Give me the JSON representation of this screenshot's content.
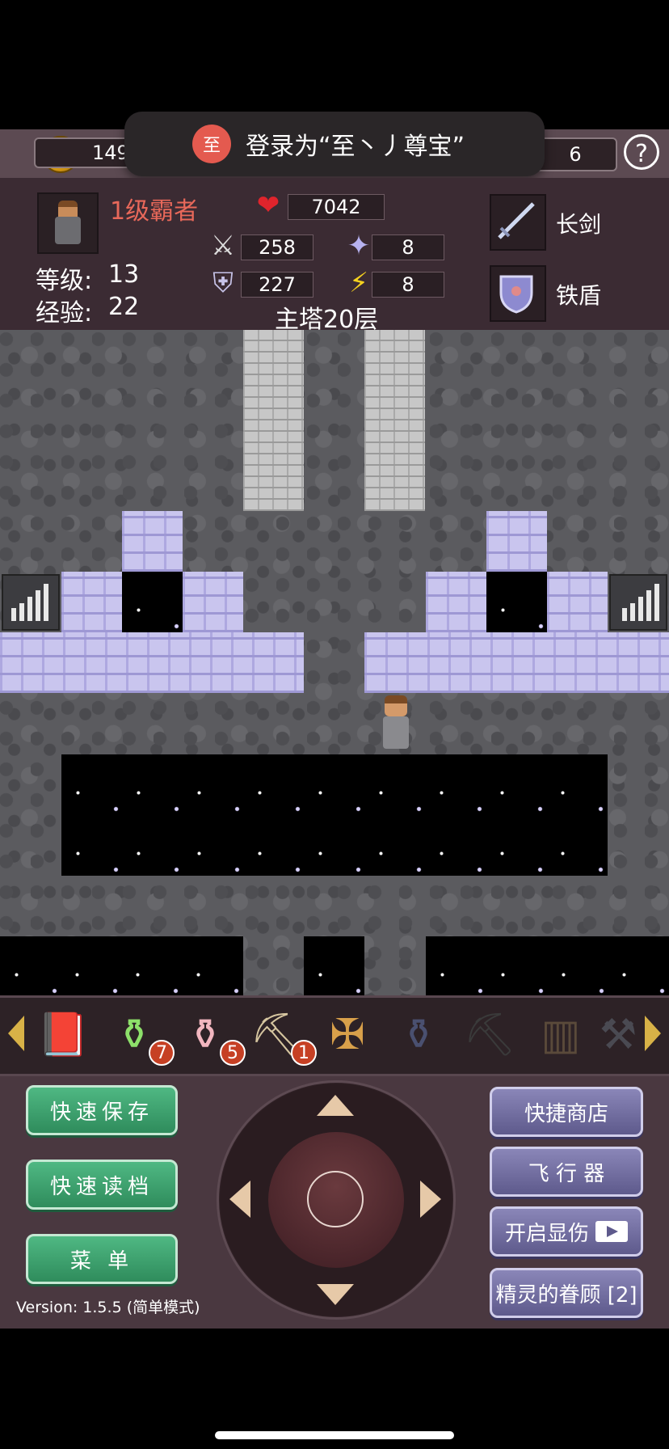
{
  "topbar": {
    "coins": "149",
    "right_value": "6",
    "help_label": "?"
  },
  "toast": {
    "avatar_char": "至",
    "text": "登录为“至丶丿尊宝”"
  },
  "hero": {
    "title": "1级霸者",
    "level_label": "等级:",
    "level": "13",
    "exp_label": "经验:",
    "exp": "22",
    "hp": "7042",
    "attack": "258",
    "defense": "227",
    "magic_def": "8",
    "speed": "8"
  },
  "equipment": {
    "weapon": "长剑",
    "shield": "铁盾"
  },
  "floor": "主塔20层",
  "items": [
    {
      "icon": "red-book-icon",
      "count": ""
    },
    {
      "icon": "green-potion-icon",
      "count": "7"
    },
    {
      "icon": "pink-potion-icon",
      "count": "5"
    },
    {
      "icon": "pickaxe-icon",
      "count": "1"
    },
    {
      "icon": "cross-staff-icon",
      "count": ""
    },
    {
      "icon": "dark-vase-icon",
      "count": ""
    },
    {
      "icon": "dark-pickaxe-icon",
      "count": ""
    },
    {
      "icon": "rune-tablet-icon",
      "count": ""
    },
    {
      "icon": "hammer-icon",
      "count": ""
    }
  ],
  "controls": {
    "quick_save": "快速保存",
    "quick_load": "快速读档",
    "menu": "菜 单",
    "shop": "快捷商店",
    "flyer": "飞 行 器",
    "show_damage": "开启显伤",
    "spirit": "精灵的眷顾 [2]",
    "version": "Version: 1.5.5 (简单模式)"
  },
  "colors": {
    "panel": "#3b2b33",
    "title_red": "#e8685a",
    "green_button": "#3fa472",
    "purple_button": "#716da0"
  }
}
